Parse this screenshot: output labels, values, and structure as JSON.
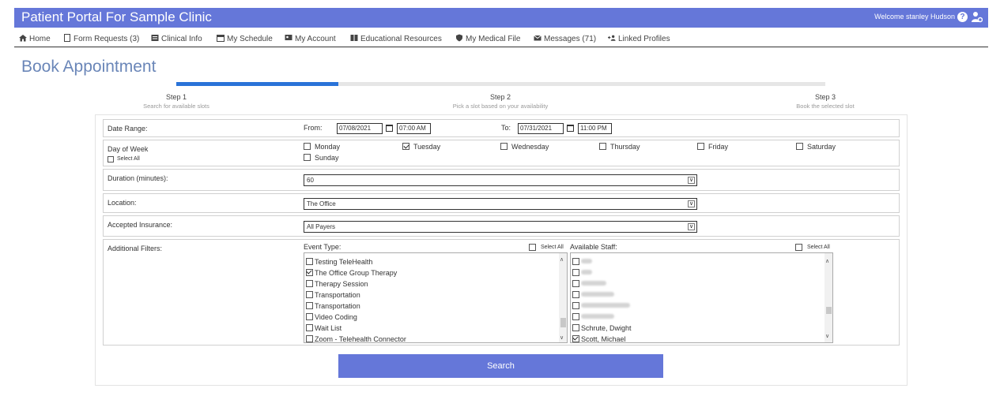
{
  "header": {
    "title": "Patient Portal For Sample Clinic",
    "welcome": "Welcome stanley Hudson",
    "help_glyph": "?",
    "icons": [
      "help-icon",
      "user-cog-icon"
    ],
    "bg_color": "#6577d9"
  },
  "nav": {
    "items": [
      {
        "label": "Home",
        "icon": "home-icon"
      },
      {
        "label": "Form Requests (3)",
        "icon": "document-icon"
      },
      {
        "label": "Clinical Info",
        "icon": "id-card-icon"
      },
      {
        "label": "My Schedule",
        "icon": "calendar-icon"
      },
      {
        "label": "My Account",
        "icon": "account-icon"
      },
      {
        "label": "Educational Resources",
        "icon": "book-icon"
      },
      {
        "label": "My Medical File",
        "icon": "shield-icon"
      },
      {
        "label": "Messages (71)",
        "icon": "envelope-icon"
      },
      {
        "label": "Linked Profiles",
        "icon": "link-user-icon"
      }
    ]
  },
  "page": {
    "title": "Book Appointment"
  },
  "progress": {
    "fraction": 0.25,
    "fill_color": "#2a73d8"
  },
  "steps": [
    {
      "title": "Step 1",
      "subtitle": "Search for available slots"
    },
    {
      "title": "Step 2",
      "subtitle": "Pick a slot based on your availability"
    },
    {
      "title": "Step 3",
      "subtitle": "Book the selected slot"
    }
  ],
  "form": {
    "date_range": {
      "label": "Date Range:",
      "from_label": "From:",
      "from_date": "07/08/2021",
      "from_time": "07:00 AM",
      "to_label": "To:",
      "to_date": "07/31/2021",
      "to_time": "11:00 PM"
    },
    "day_of_week": {
      "label": "Day of Week",
      "select_all": "Select All",
      "days": [
        {
          "label": "Monday",
          "checked": false
        },
        {
          "label": "Tuesday",
          "checked": true
        },
        {
          "label": "Wednesday",
          "checked": false
        },
        {
          "label": "Thursday",
          "checked": false
        },
        {
          "label": "Friday",
          "checked": false
        },
        {
          "label": "Saturday",
          "checked": false
        },
        {
          "label": "Sunday",
          "checked": false
        }
      ]
    },
    "duration": {
      "label": "Duration (minutes):",
      "value": "60"
    },
    "location": {
      "label": "Location:",
      "value": "The Office"
    },
    "insurance": {
      "label": "Accepted Insurance:",
      "value": "All Payers"
    },
    "filters": {
      "label": "Additional Filters:",
      "event_type_label": "Event Type:",
      "event_select_all": "Select All",
      "event_types": [
        {
          "label": "Testing TeleHealth",
          "checked": false
        },
        {
          "label": "The Office Group Therapy",
          "checked": true
        },
        {
          "label": "Therapy Session",
          "checked": false
        },
        {
          "label": "Transportation",
          "checked": false
        },
        {
          "label": "Transportation",
          "checked": false
        },
        {
          "label": "Video Coding",
          "checked": false
        },
        {
          "label": "Wait List",
          "checked": false
        },
        {
          "label": "Zoom - Telehealth Connector",
          "checked": false
        }
      ],
      "staff_label": "Available Staff:",
      "staff_select_all": "Select All",
      "staff": [
        {
          "label": "Schrute, Dwight",
          "checked": false
        },
        {
          "label": "Scott, Michael",
          "checked": true
        }
      ]
    }
  },
  "search_button": {
    "label": "Search",
    "color": "#6577d9"
  }
}
